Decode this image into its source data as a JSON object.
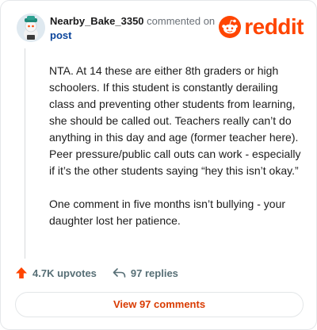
{
  "comment": {
    "username": "Nearby_Bake_3350",
    "commented_text": "commented on",
    "post_link": "post",
    "paragraphs": [
      "NTA. At 14 these are either 8th graders or high schoolers. If this student is constantly derailing class and preventing other students from learning, she should be called out. Teachers really can’t do anything in this day and age (former teacher here). Peer pressure/public call outs can work - especially if it’s the other students saying “hey this isn’t okay.”",
      "One comment in five months isn’t bullying - your daughter lost her patience."
    ]
  },
  "brand": {
    "name": "reddit",
    "icon": "reddit-alien-icon",
    "color": "#ff4500"
  },
  "actions": {
    "upvotes": "4.7K upvotes",
    "replies": "97 replies"
  },
  "footer": {
    "view_comments": "View 97 comments"
  }
}
